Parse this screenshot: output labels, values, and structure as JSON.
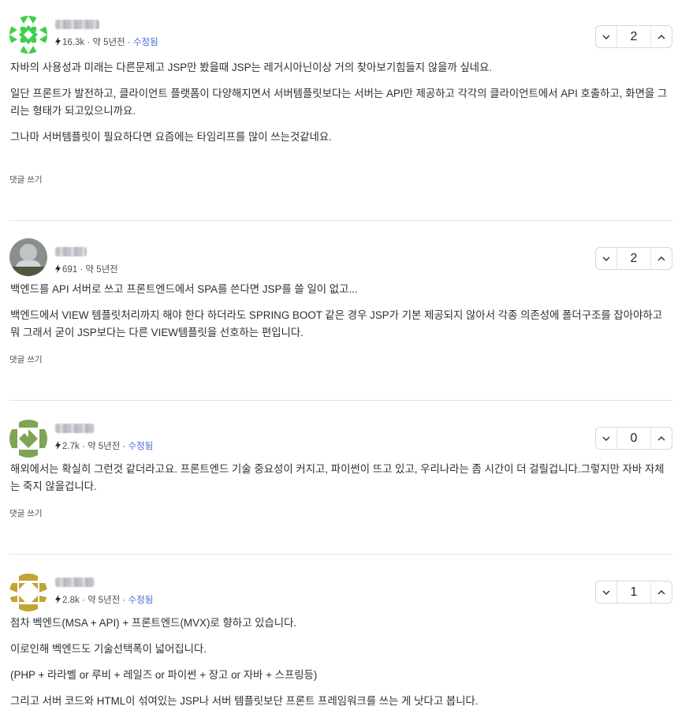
{
  "comments": [
    {
      "reputation": "16.3k",
      "time": "약 5년전",
      "edited": "수정됨",
      "votes": "2",
      "paragraphs": [
        "자바의 사용성과 미래는 다른문제고 JSP만 봤을때 JSP는 레거시아닌이상 거의 찾아보기힘들지 않을까 싶네요.",
        "일단 프론트가 발전하고, 클라이언트 플랫폼이 다양해지면서 서버템플릿보다는 서버는 API만 제공하고 각각의 클라이언트에서 API 호출하고, 화면을 그리는 형태가 되고있으니까요.",
        "그나마 서버템플릿이 필요하다면 요즘에는 타임리프를 많이 쓰는것같네요."
      ],
      "reply_label": "댓글 쓰기",
      "avatar_color": "#3ecf4a"
    },
    {
      "reputation": "691",
      "time": "약 5년전",
      "edited": "",
      "votes": "2",
      "paragraphs": [
        "백엔드를 API 서버로 쓰고 프론트엔드에서 SPA를 쓴다면 JSP를 쓸 일이 없고...",
        "백엔드에서 VIEW 템플릿처리까지 해야 한다 하더라도 SPRING BOOT 같은 경우 JSP가 기본 제공되지 않아서 각종 의존성에 폴더구조를 잡아야하고 뭐 그래서 굳이 JSP보다는 다른 VIEW템플릿을 선호하는 편입니다."
      ],
      "reply_label": "댓글 쓰기",
      "avatar_color": "#7c8580"
    },
    {
      "reputation": "2.7k",
      "time": "약 5년전",
      "edited": "수정됨",
      "votes": "0",
      "paragraphs": [
        "해외에서는 확실히 그런것 같더라고요. 프론트엔드 기술 중요성이 커지고, 파이썬이 뜨고 있고,  우리나라는 좀 시간이 더 걸릴겁니다.그렇지만 자바 자체는 죽지 않을겁니다."
      ],
      "reply_label": "댓글 쓰기",
      "avatar_color": "#7ea454"
    },
    {
      "reputation": "2.8k",
      "time": "약 5년전",
      "edited": "수정됨",
      "votes": "1",
      "paragraphs": [
        "점차 벡엔드(MSA + API) + 프론트엔드(MVX)로 향하고 있습니다.",
        "이로인해 벡엔드도 기술선택폭이 넓어집니다.",
        "(PHP + 라라벨 or 루비 + 레일즈 or 파이썬 + 장고 or 자바 + 스프링등)",
        "그리고 서버 코드와 HTML이 섞여있는 JSP나 서버 템플릿보단 프론트 프레임워크를 쓰는 게 낫다고 봅니다."
      ],
      "reply_label": "",
      "avatar_color": "#c2a336"
    }
  ],
  "icons": {
    "reputation": "bolt-icon",
    "downvote": "chevron-down-icon",
    "upvote": "chevron-up-icon"
  }
}
